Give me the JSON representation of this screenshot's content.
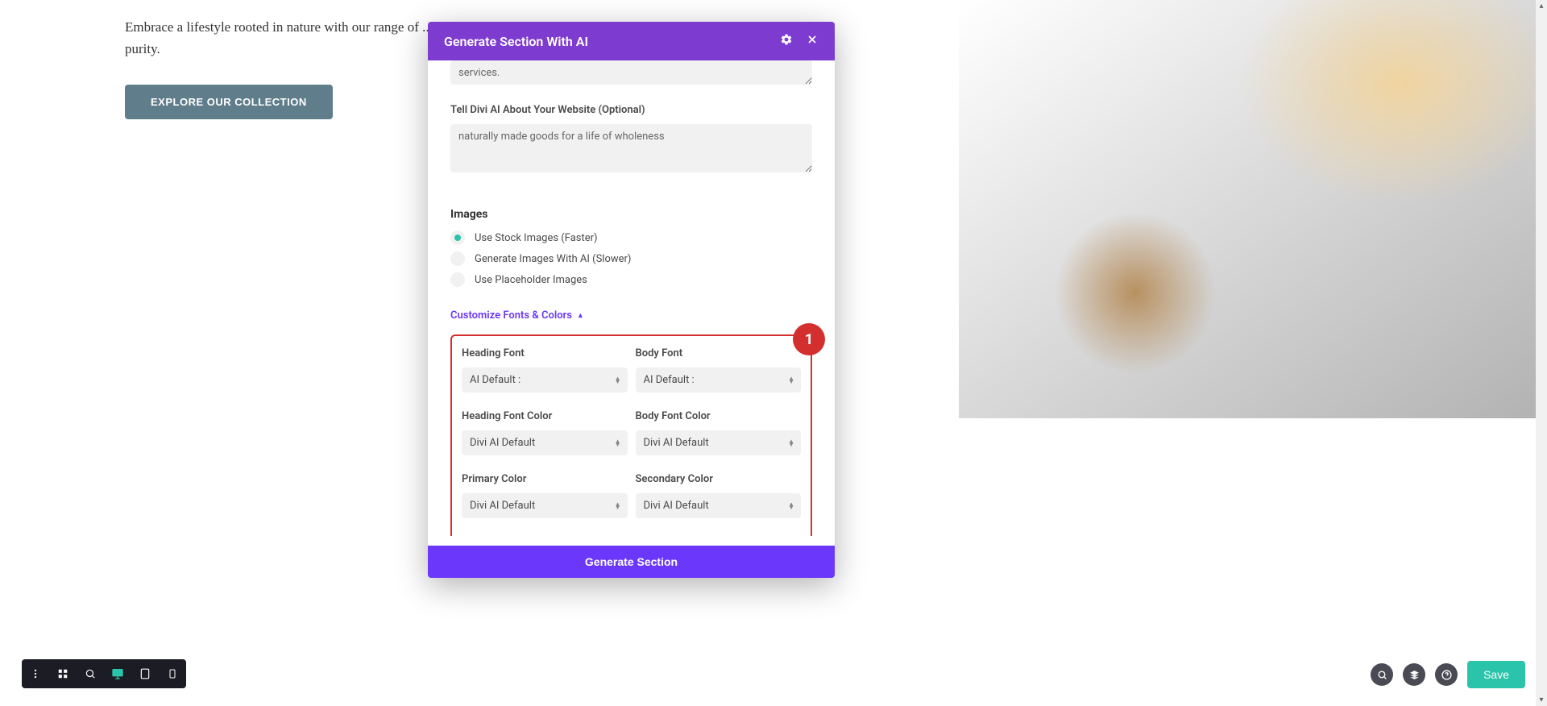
{
  "background": {
    "paragraph": "Embrace a lifestyle rooted in nature with our range of ... ... with care and dedication to purity.",
    "explore_button": "EXPLORE OUR COLLECTION"
  },
  "modal": {
    "title": "Generate Section With AI",
    "services_value": "services.",
    "website_label": "Tell Divi AI About Your Website (Optional)",
    "website_value": "naturally made goods for a life of wholeness",
    "images_title": "Images",
    "image_options": [
      {
        "label": "Use Stock Images (Faster)",
        "selected": true
      },
      {
        "label": "Generate Images With AI (Slower)",
        "selected": false
      },
      {
        "label": "Use Placeholder Images",
        "selected": false
      }
    ],
    "customize_link": "Customize Fonts & Colors",
    "badge": "1",
    "fields": {
      "heading_font": {
        "label": "Heading Font",
        "value": "AI Default :"
      },
      "body_font": {
        "label": "Body Font",
        "value": "AI Default :"
      },
      "heading_color": {
        "label": "Heading Font Color",
        "value": "Divi AI Default"
      },
      "body_color": {
        "label": "Body Font Color",
        "value": "Divi AI Default"
      },
      "primary_color": {
        "label": "Primary Color",
        "value": "Divi AI Default"
      },
      "secondary_color": {
        "label": "Secondary Color",
        "value": "Divi AI Default"
      }
    },
    "generate_button": "Generate Section"
  },
  "toolbar": {
    "save_label": "Save"
  }
}
